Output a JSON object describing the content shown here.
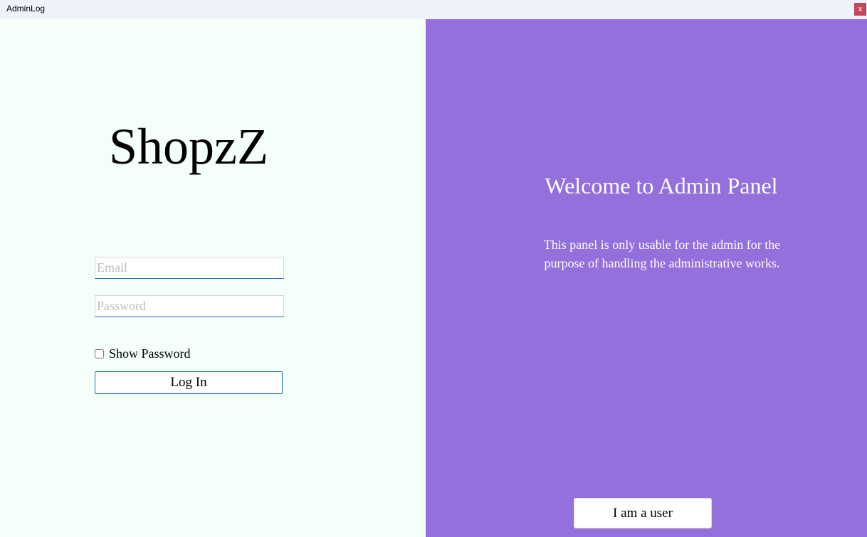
{
  "window": {
    "title": "AdminLog",
    "close_label": "x"
  },
  "colors": {
    "left_bg": "#f4fff9",
    "right_bg": "#9370db",
    "accent": "#1b6db5",
    "close_bg": "#c4475c"
  },
  "left": {
    "logo": "ShopzZ",
    "email": {
      "value": "",
      "placeholder": "Email"
    },
    "password": {
      "value": "",
      "placeholder": "Password"
    },
    "show_password": {
      "label": "Show Password",
      "checked": false
    },
    "login_label": "Log In"
  },
  "right": {
    "heading": "Welcome to Admin Panel",
    "description": "This panel is only usable for the admin for the purpose of handling the administrative works.",
    "user_button_label": "I am a user"
  }
}
